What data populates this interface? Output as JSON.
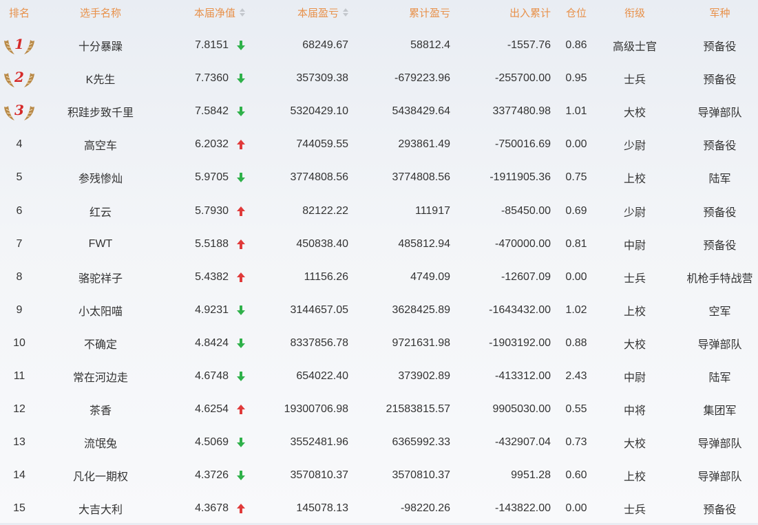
{
  "header": {
    "rank": "排名",
    "name": "选手名称",
    "nav": "本届净值",
    "pl": "本届盈亏",
    "cum_pl": "累计盈亏",
    "flow": "出入累计",
    "position": "仓位",
    "rank_title": "衔级",
    "branch": "军种"
  },
  "colors": {
    "header_text": "#e8914a",
    "arrow_up": "#e03a3a",
    "arrow_down": "#2fb14a",
    "medal_number": "#d42a2a",
    "medal_wing": "#b98a48"
  },
  "rows": [
    {
      "rank": "1",
      "name": "十分暴躁",
      "nav": "7.8151",
      "trend": "down",
      "pl": "68249.67",
      "cum_pl": "58812.4",
      "flow": "-1557.76",
      "position": "0.86",
      "rank_title": "高级士官",
      "branch": "预备役"
    },
    {
      "rank": "2",
      "name": "K先生",
      "nav": "7.7360",
      "trend": "down",
      "pl": "357309.38",
      "cum_pl": "-679223.96",
      "flow": "-255700.00",
      "position": "0.95",
      "rank_title": "士兵",
      "branch": "预备役"
    },
    {
      "rank": "3",
      "name": "积跬步致千里",
      "nav": "7.5842",
      "trend": "down",
      "pl": "5320429.10",
      "cum_pl": "5438429.64",
      "flow": "3377480.98",
      "position": "1.01",
      "rank_title": "大校",
      "branch": "导弹部队"
    },
    {
      "rank": "4",
      "name": "高空车",
      "nav": "6.2032",
      "trend": "up",
      "pl": "744059.55",
      "cum_pl": "293861.49",
      "flow": "-750016.69",
      "position": "0.00",
      "rank_title": "少尉",
      "branch": "预备役"
    },
    {
      "rank": "5",
      "name": "参残惨灿",
      "nav": "5.9705",
      "trend": "down",
      "pl": "3774808.56",
      "cum_pl": "3774808.56",
      "flow": "-1911905.36",
      "position": "0.75",
      "rank_title": "上校",
      "branch": "陆军"
    },
    {
      "rank": "6",
      "name": "红云",
      "nav": "5.7930",
      "trend": "up",
      "pl": "82122.22",
      "cum_pl": "111917",
      "flow": "-85450.00",
      "position": "0.69",
      "rank_title": "少尉",
      "branch": "预备役"
    },
    {
      "rank": "7",
      "name": "FWT",
      "nav": "5.5188",
      "trend": "up",
      "pl": "450838.40",
      "cum_pl": "485812.94",
      "flow": "-470000.00",
      "position": "0.81",
      "rank_title": "中尉",
      "branch": "预备役"
    },
    {
      "rank": "8",
      "name": "骆驼祥子",
      "nav": "5.4382",
      "trend": "up",
      "pl": "11156.26",
      "cum_pl": "4749.09",
      "flow": "-12607.09",
      "position": "0.00",
      "rank_title": "士兵",
      "branch": "机枪手特战营"
    },
    {
      "rank": "9",
      "name": "小太阳喵",
      "nav": "4.9231",
      "trend": "down",
      "pl": "3144657.05",
      "cum_pl": "3628425.89",
      "flow": "-1643432.00",
      "position": "1.02",
      "rank_title": "上校",
      "branch": "空军"
    },
    {
      "rank": "10",
      "name": "不确定",
      "nav": "4.8424",
      "trend": "down",
      "pl": "8337856.78",
      "cum_pl": "9721631.98",
      "flow": "-1903192.00",
      "position": "0.88",
      "rank_title": "大校",
      "branch": "导弹部队"
    },
    {
      "rank": "11",
      "name": "常在河边走",
      "nav": "4.6748",
      "trend": "down",
      "pl": "654022.40",
      "cum_pl": "373902.89",
      "flow": "-413312.00",
      "position": "2.43",
      "rank_title": "中尉",
      "branch": "陆军"
    },
    {
      "rank": "12",
      "name": "茶香",
      "nav": "4.6254",
      "trend": "up",
      "pl": "19300706.98",
      "cum_pl": "21583815.57",
      "flow": "9905030.00",
      "position": "0.55",
      "rank_title": "中将",
      "branch": "集团军"
    },
    {
      "rank": "13",
      "name": "流氓兔",
      "nav": "4.5069",
      "trend": "down",
      "pl": "3552481.96",
      "cum_pl": "6365992.33",
      "flow": "-432907.04",
      "position": "0.73",
      "rank_title": "大校",
      "branch": "导弹部队"
    },
    {
      "rank": "14",
      "name": "凡化一期权",
      "nav": "4.3726",
      "trend": "down",
      "pl": "3570810.37",
      "cum_pl": "3570810.37",
      "flow": "9951.28",
      "position": "0.60",
      "rank_title": "上校",
      "branch": "导弹部队"
    },
    {
      "rank": "15",
      "name": "大吉大利",
      "nav": "4.3678",
      "trend": "up",
      "pl": "145078.13",
      "cum_pl": "-98220.26",
      "flow": "-143822.00",
      "position": "0.00",
      "rank_title": "士兵",
      "branch": "预备役"
    }
  ]
}
